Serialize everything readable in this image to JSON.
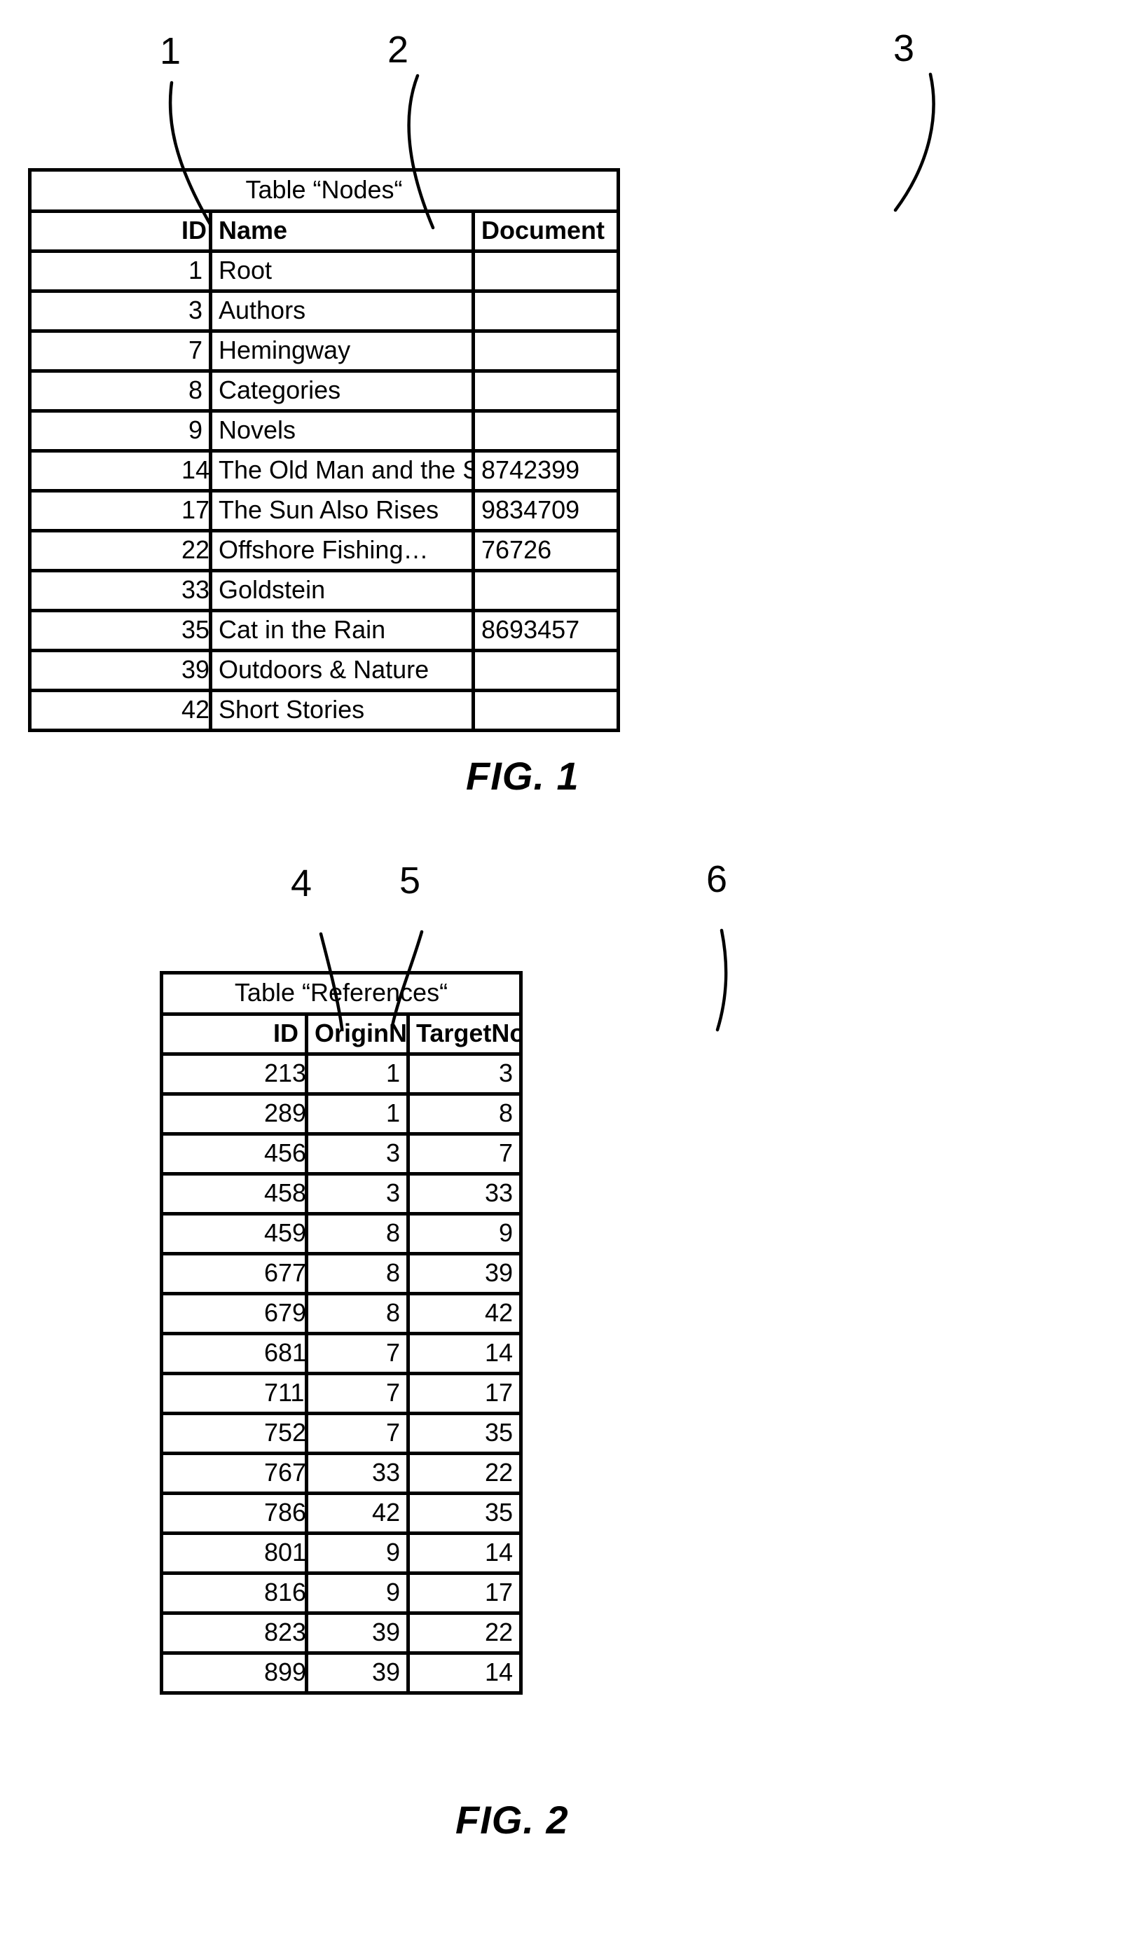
{
  "figure1": {
    "caption": "FIG. 1",
    "table_title": "Table “Nodes“",
    "ref_numerals": [
      {
        "label": "1"
      },
      {
        "label": "2"
      },
      {
        "label": "3"
      }
    ],
    "columns": [
      "",
      "ID",
      "Name",
      "Document"
    ],
    "rows": [
      {
        "id": "1",
        "name": "Root",
        "document": ""
      },
      {
        "id": "3",
        "name": "Authors",
        "document": ""
      },
      {
        "id": "7",
        "name": "Hemingway",
        "document": ""
      },
      {
        "id": "8",
        "name": "Categories",
        "document": ""
      },
      {
        "id": "9",
        "name": "Novels",
        "document": ""
      },
      {
        "id": "14",
        "name": "The Old Man and the Sea",
        "document": "8742399"
      },
      {
        "id": "17",
        "name": "The Sun Also Rises",
        "document": "9834709"
      },
      {
        "id": "22",
        "name": "Offshore Fishing…",
        "document": "76726"
      },
      {
        "id": "33",
        "name": "Goldstein",
        "document": ""
      },
      {
        "id": "35",
        "name": "Cat in the Rain",
        "document": "8693457"
      },
      {
        "id": "39",
        "name": "Outdoors & Nature",
        "document": ""
      },
      {
        "id": "42",
        "name": "Short Stories",
        "document": ""
      }
    ]
  },
  "figure2": {
    "caption": "FIG. 2",
    "table_title": "Table “References“",
    "ref_numerals": [
      {
        "label": "4"
      },
      {
        "label": "5"
      },
      {
        "label": "6"
      }
    ],
    "columns": [
      "",
      "ID",
      "OriginNodeID",
      "TargetNodeID"
    ],
    "rows": [
      {
        "id": "213",
        "origin": "1",
        "target": "3"
      },
      {
        "id": "289",
        "origin": "1",
        "target": "8"
      },
      {
        "id": "456",
        "origin": "3",
        "target": "7"
      },
      {
        "id": "458",
        "origin": "3",
        "target": "33"
      },
      {
        "id": "459",
        "origin": "8",
        "target": "9"
      },
      {
        "id": "677",
        "origin": "8",
        "target": "39"
      },
      {
        "id": "679",
        "origin": "8",
        "target": "42"
      },
      {
        "id": "681",
        "origin": "7",
        "target": "14"
      },
      {
        "id": "711",
        "origin": "7",
        "target": "17"
      },
      {
        "id": "752",
        "origin": "7",
        "target": "35"
      },
      {
        "id": "767",
        "origin": "33",
        "target": "22"
      },
      {
        "id": "786",
        "origin": "42",
        "target": "35"
      },
      {
        "id": "801",
        "origin": "9",
        "target": "14"
      },
      {
        "id": "816",
        "origin": "9",
        "target": "17"
      },
      {
        "id": "823",
        "origin": "39",
        "target": "22"
      },
      {
        "id": "899",
        "origin": "39",
        "target": "14"
      }
    ]
  },
  "colors": {
    "ink": "#000000",
    "paper": "#ffffff"
  }
}
